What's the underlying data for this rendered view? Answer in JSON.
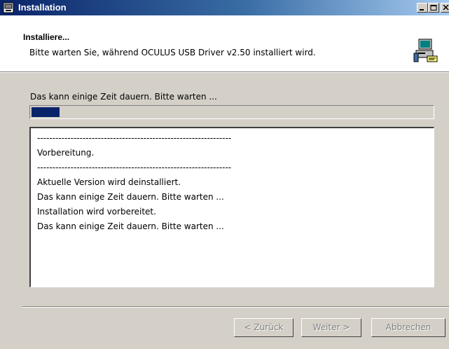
{
  "window": {
    "title": "Installation"
  },
  "header": {
    "title": "Installiere...",
    "subtitle": "Bitte warten Sie, während OCULUS USB Driver v2.50 installiert wird.",
    "icon": "installer-computer-icon"
  },
  "progress": {
    "status_text": "Das kann einige Zeit dauern. Bitte warten ...",
    "fraction": 0.07
  },
  "log": {
    "lines": [
      "----------------------------------------------------------------",
      "Vorbereitung.",
      "----------------------------------------------------------------",
      "Aktuelle Version wird deinstalliert.",
      "Das kann einige Zeit dauern. Bitte warten ...",
      "Installation wird vorbereitet.",
      "Das kann einige Zeit dauern. Bitte warten ..."
    ]
  },
  "buttons": {
    "back": "< Zurück",
    "next": "Weiter >",
    "cancel": "Abbrechen"
  },
  "colors": {
    "titlebar_start": "#0a246a",
    "titlebar_end": "#a6caf0",
    "progress_fill": "#0a246a",
    "dialog_bg": "#d4d0c8"
  }
}
